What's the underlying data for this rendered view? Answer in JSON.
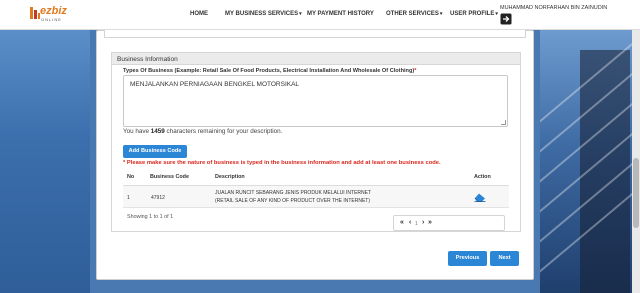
{
  "header": {
    "logo": {
      "brand": "ezbiz",
      "sub": "ONLINE"
    },
    "nav": [
      {
        "label": "HOME"
      },
      {
        "label": "MY BUSINESS SERVICES"
      },
      {
        "label": "MY PAYMENT HISTORY"
      },
      {
        "label": "OTHER SERVICES"
      },
      {
        "label": "USER PROFILE"
      }
    ],
    "user_name": "MUHAMMAD NORFARHAN BIN ZAINUDIN"
  },
  "section": {
    "title": "Business Information",
    "field_label": "Types Of Business (Example: Retail Sale Of Food Products, Electrical Installation And Wholesale Of Clothing)",
    "required_mark": "*",
    "textarea_value": "MENJALANKAN PERNIAGAAN BENGKEL MOTORSIKAL",
    "remaining_prefix": "You have ",
    "remaining_count": "1459",
    "remaining_suffix": " characters remaining for your description.",
    "add_button": "Add Business Code",
    "warning": "* Please make sure the nature of business is typed in the business information and add at least one business code."
  },
  "table": {
    "headers": {
      "no": "No",
      "code": "Business Code",
      "desc": "Description",
      "action": "Action"
    },
    "rows": [
      {
        "no": "1",
        "code": "47912",
        "desc_line1": "JUALAN RUNCIT SEBARANG JENIS PRODUK MELALUI INTERNET",
        "desc_line2": "(RETAIL SALE OF ANY KIND OF PRODUCT OVER THE INTERNET)"
      }
    ],
    "showing": "Showing 1 to 1 of 1",
    "pager": {
      "first": "«",
      "prev": "‹",
      "current": "1",
      "next": "›",
      "last": "»"
    }
  },
  "buttons": {
    "previous": "Previous",
    "next": "Next"
  },
  "colors": {
    "primary": "#2c86d6",
    "danger": "#d9261c",
    "brand": "#e07a1f"
  }
}
